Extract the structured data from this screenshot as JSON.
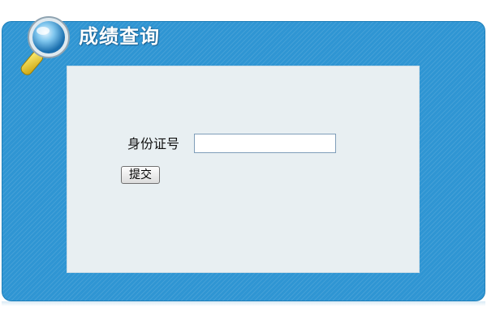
{
  "header": {
    "title": "成绩查询",
    "icon": "magnifier-icon"
  },
  "form": {
    "id_label": "身份证号",
    "id_value": "",
    "id_placeholder": "",
    "submit_label": "提交"
  },
  "colors": {
    "panel_blue": "#2f95d3",
    "content_bg": "#e8eff2",
    "title_text": "#ffffff"
  }
}
